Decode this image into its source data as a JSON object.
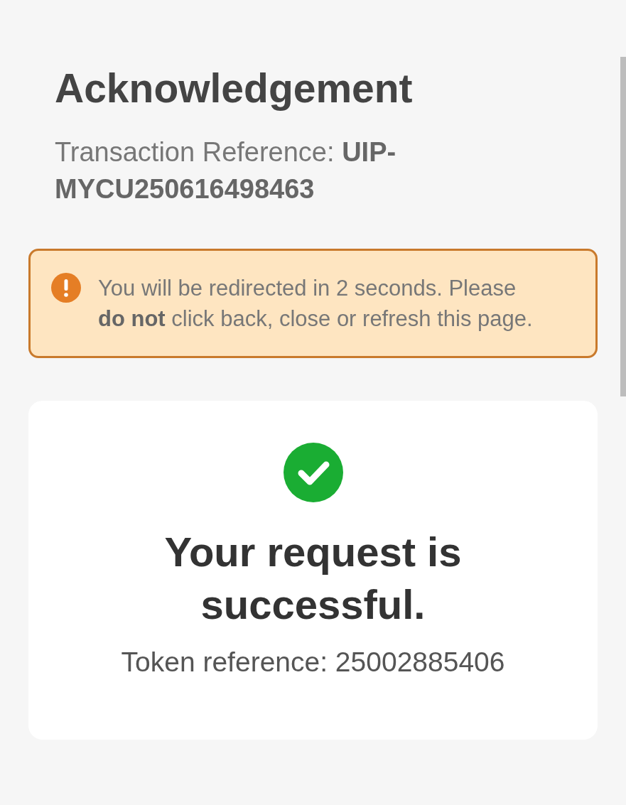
{
  "page": {
    "title": "Acknowledgement",
    "reference": "Transaction Reference: **UIP-MYCU250616498463**"
  },
  "alert": {
    "kind": "warning",
    "message": "You will be redirected in 2 seconds. Please **do not** click back, close or refresh this page."
  },
  "result": {
    "succeeded": true,
    "heading": "Your request is successful.",
    "token": "Token reference: 25002885406"
  }
}
